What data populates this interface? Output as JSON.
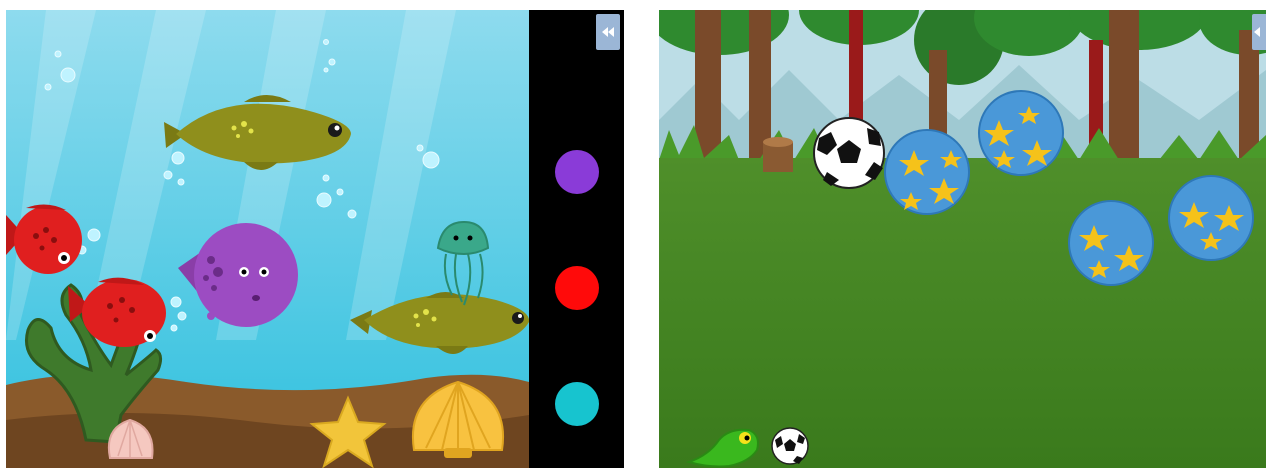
{
  "screens": [
    {
      "id": "aquarium",
      "colors": {
        "water_top": "#7fd3ea",
        "water_bottom": "#3fc3df",
        "sand": "#8a5a2b",
        "sand_dark": "#6e4520",
        "panel_bg": "#000000"
      },
      "palette": [
        {
          "name": "purple",
          "color": "#8a3bd8"
        },
        {
          "name": "red",
          "color": "#ff0a0a"
        },
        {
          "name": "cyan",
          "color": "#17c4cf"
        }
      ],
      "creatures": {
        "olive_fish": "olive-fish-icon",
        "red_fish": "red-fish-icon",
        "purple_fish": "purple-fish-icon",
        "jellyfish": "jellyfish-icon",
        "seaweed": "seaweed-icon",
        "starfish": "starfish-icon",
        "shell": "seashell-icon"
      },
      "collapse_icon": "double-chevron-left-icon"
    },
    {
      "id": "forest",
      "colors": {
        "sky": "#b9dde8",
        "grass_top": "#4c8a2a",
        "grass_bottom": "#3a7a1e",
        "trunk": "#7a4a2a",
        "leaves": "#2f8a2f"
      },
      "balls": {
        "soccer": "soccer-ball-icon",
        "star": "star-ball-icon"
      },
      "character": "green-lizard-icon",
      "collapse_icon": "double-chevron-left-icon"
    }
  ]
}
